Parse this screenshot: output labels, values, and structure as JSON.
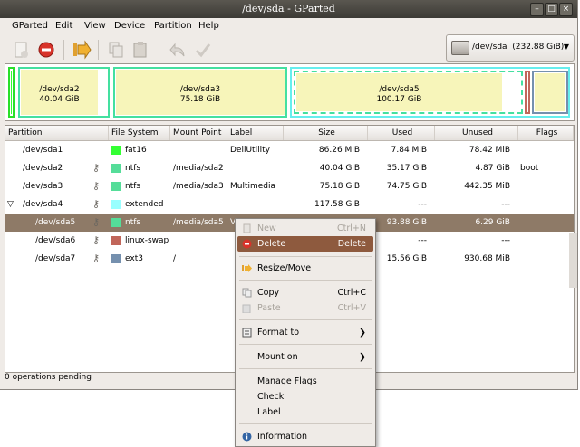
{
  "window": {
    "title": "/dev/sda - GParted"
  },
  "menubar": [
    "GParted",
    "Edit",
    "View",
    "Device",
    "Partition",
    "Help"
  ],
  "device_selector": {
    "label": "/dev/sda",
    "size": "(232.88 GiB)"
  },
  "partition_map": [
    {
      "name": "/dev/sda2",
      "size": "40.04 GiB"
    },
    {
      "name": "/dev/sda3",
      "size": "75.18 GiB"
    },
    {
      "name": "/dev/sda5",
      "size": "100.17 GiB"
    }
  ],
  "table": {
    "headers": [
      "Partition",
      "File System",
      "Mount Point",
      "Label",
      "Size",
      "Used",
      "Unused",
      "Flags"
    ],
    "rows": [
      {
        "partition": "/dev/sda1",
        "fs": "fat16",
        "fs_color": "#33ff33",
        "mount": "",
        "label": "DellUtility",
        "size": "86.26 MiB",
        "used": "7.84 MiB",
        "unused": "78.42 MiB",
        "flags": "",
        "key": false,
        "indent": false
      },
      {
        "partition": "/dev/sda2",
        "fs": "ntfs",
        "fs_color": "#55dd99",
        "mount": "/media/sda2",
        "label": "",
        "size": "40.04 GiB",
        "used": "35.17 GiB",
        "unused": "4.87 GiB",
        "flags": "boot",
        "key": true,
        "indent": false
      },
      {
        "partition": "/dev/sda3",
        "fs": "ntfs",
        "fs_color": "#55dd99",
        "mount": "/media/sda3",
        "label": "Multimedia",
        "size": "75.18 GiB",
        "used": "74.75 GiB",
        "unused": "442.35 MiB",
        "flags": "",
        "key": true,
        "indent": false
      },
      {
        "partition": "/dev/sda4",
        "fs": "extended",
        "fs_color": "#99ffff",
        "mount": "",
        "label": "",
        "size": "117.58 GiB",
        "used": "---",
        "unused": "---",
        "flags": "",
        "key": true,
        "indent": false,
        "expander": "▽"
      },
      {
        "partition": "/dev/sda5",
        "fs": "ntfs",
        "fs_color": "#55dd99",
        "mount": "/media/sda5",
        "label": "V",
        "size": "",
        "used": "93.88 GiB",
        "unused": "6.29 GiB",
        "flags": "",
        "key": true,
        "indent": true,
        "selected": true
      },
      {
        "partition": "/dev/sda6",
        "fs": "linux-swap",
        "fs_color": "#c1665a",
        "mount": "",
        "label": "",
        "size": "",
        "used": "---",
        "unused": "---",
        "flags": "",
        "key": true,
        "indent": true
      },
      {
        "partition": "/dev/sda7",
        "fs": "ext3",
        "fs_color": "#7590ae",
        "mount": "/",
        "label": "",
        "size": "",
        "used": "15.56 GiB",
        "unused": "930.68 MiB",
        "flags": "",
        "key": true,
        "indent": true
      }
    ]
  },
  "status": "0 operations pending",
  "context_menu": {
    "items": [
      {
        "label": "New",
        "shortcut": "Ctrl+N",
        "disabled": true
      },
      {
        "label": "Delete",
        "shortcut": "Delete",
        "highlighted": true
      },
      {
        "label": "Resize/Move"
      },
      {
        "label": "Copy",
        "shortcut": "Ctrl+C"
      },
      {
        "label": "Paste",
        "shortcut": "Ctrl+V",
        "disabled": true
      },
      {
        "label": "Format to",
        "submenu": "❯"
      },
      {
        "label": "Mount on",
        "submenu": "❯"
      },
      {
        "label": "Manage Flags"
      },
      {
        "label": "Check"
      },
      {
        "label": "Label"
      },
      {
        "label": "Information"
      }
    ]
  }
}
